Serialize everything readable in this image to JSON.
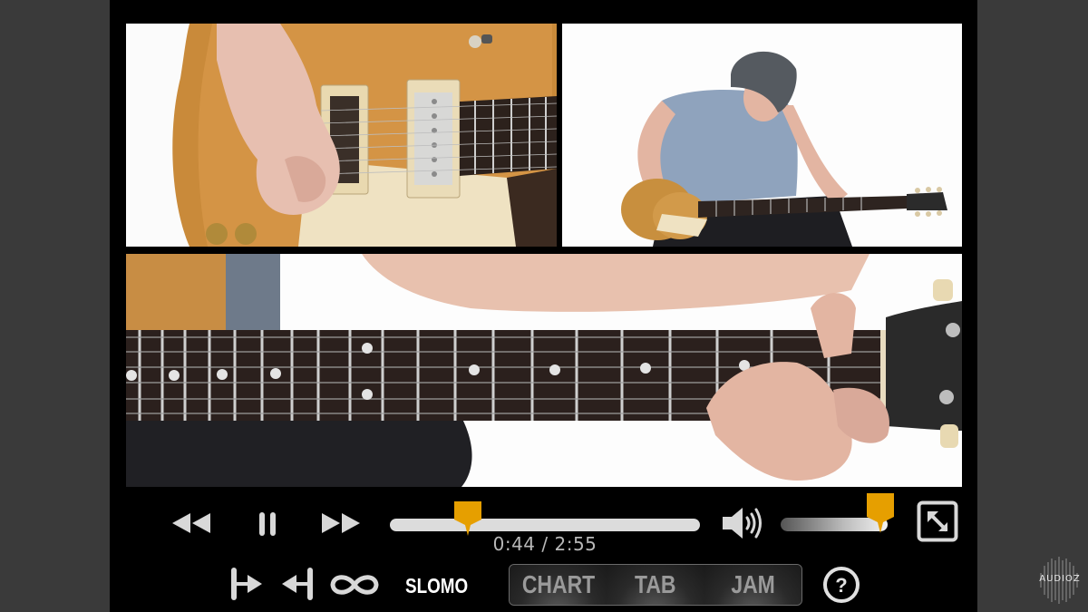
{
  "player": {
    "elapsed": "0:44",
    "duration": "2:55",
    "time_display": "0:44 / 2:55",
    "progress_fraction": 0.251,
    "volume_fraction": 0.93,
    "accent_color": "#e69f00"
  },
  "controls": {
    "rewind_icon": "rewind-icon",
    "pause_icon": "pause-icon",
    "fast_forward_icon": "fast-forward-icon",
    "volume_icon": "speaker-volume-icon",
    "exit_fullscreen_icon": "exit-fullscreen-icon",
    "loop_start_icon": "loop-start-marker-icon",
    "loop_end_icon": "loop-end-marker-icon",
    "loop_icon": "infinity-loop-icon",
    "slomo_label": "SLOMO",
    "help_icon": "help-question-icon"
  },
  "view_modes": [
    {
      "label": "CHART"
    },
    {
      "label": "TAB"
    },
    {
      "label": "JAM"
    }
  ],
  "video_panels": [
    {
      "name": "pickup-closeup"
    },
    {
      "name": "full-player-view"
    },
    {
      "name": "fretboard-closeup"
    }
  ],
  "watermark": {
    "text": "AUDIOZ"
  }
}
